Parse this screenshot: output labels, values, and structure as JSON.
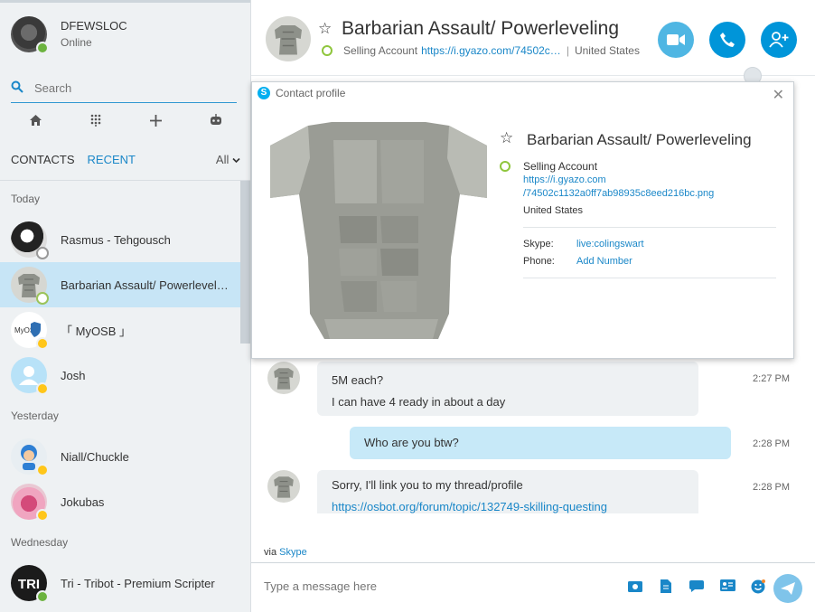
{
  "me": {
    "name": "DFEWSLOC",
    "status": "Online"
  },
  "search": {
    "placeholder": "Search"
  },
  "tabs": {
    "contacts": "CONTACTS",
    "recent": "RECENT",
    "filter": "All"
  },
  "sections": {
    "today": "Today",
    "yesterday": "Yesterday",
    "wednesday": "Wednesday"
  },
  "contacts": [
    {
      "name": "Rasmus - Tehgousch",
      "status": "unknown"
    },
    {
      "name": "Barbarian Assault/ Powerleveling",
      "status": "offline",
      "selected": true
    },
    {
      "name": "「 MyOSB 」",
      "status": "away"
    },
    {
      "name": "Josh",
      "status": "away"
    },
    {
      "name": "Niall/Chuckle",
      "status": "away"
    },
    {
      "name": "Jokubas",
      "status": "away"
    },
    {
      "name": "Tri - Tribot - Premium Scripter",
      "status": "online"
    }
  ],
  "header": {
    "title": "Barbarian Assault/ Powerleveling",
    "mood": "Selling Account",
    "link": "https://i.gyazo.com/74502c…",
    "location": "United States"
  },
  "messages": [
    {
      "direction": "in",
      "lines": [
        "5M each?",
        "I can have 4 ready in about a day"
      ],
      "time": "2:27 PM"
    },
    {
      "direction": "out",
      "lines": [
        "Who are you btw?"
      ],
      "time": "2:28 PM"
    },
    {
      "direction": "in",
      "lines": [
        "Sorry, I'll link you to my thread/profile",
        "https://osbot.org/forum/topic/132749-skilling-questing"
      ],
      "time": "2:28 PM"
    }
  ],
  "via": {
    "prefix": "via",
    "service": "Skype"
  },
  "compose": {
    "placeholder": "Type a message here"
  },
  "profile": {
    "window_title": "Contact profile",
    "name": "Barbarian Assault/ Powerleveling",
    "mood": "Selling Account",
    "url_line1": "https://i.gyazo.com",
    "url_line2": "/74502c1132a0ff7ab98935c8eed216bc.png",
    "location": "United States",
    "skype_label": "Skype:",
    "skype_value": "live:colingswart",
    "phone_label": "Phone:",
    "phone_value": "Add Number"
  },
  "colors": {
    "accent": "#1a87c8",
    "selected": "#c7e5f6",
    "online": "#6cb33f",
    "away": "#ffc61a"
  }
}
